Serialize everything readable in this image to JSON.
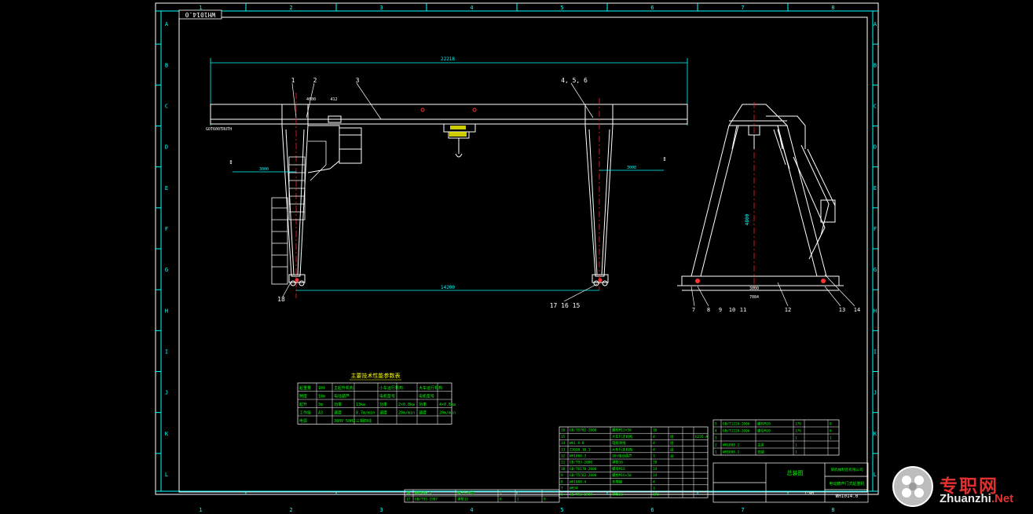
{
  "drawing": {
    "number_box": "WH1014.0",
    "column_labels": [
      "1",
      "2",
      "3",
      "4",
      "5",
      "6",
      "7",
      "8"
    ],
    "row_labels": [
      "A",
      "B",
      "C",
      "D",
      "E",
      "F",
      "G",
      "H",
      "I",
      "J",
      "K",
      "L"
    ],
    "front_view": {
      "span_dim": "22218",
      "rail_dim": "14200",
      "left_overhang": "3000",
      "right_overhang": "3000",
      "hook_level": "GOT600TRUTH",
      "detail_dim_a": "4600",
      "detail_dim_b": "412",
      "callouts_top": [
        "1",
        "2",
        "3",
        "4, 5, 6"
      ],
      "callouts_bottom_left": "18",
      "callouts_bottom_right": "17  16  15"
    },
    "side_view": {
      "height_dim": "4800",
      "base_dim_a": "3000",
      "base_dim_b": "7084",
      "callouts": [
        "7",
        "8",
        "9",
        "10",
        "11",
        "12",
        "13",
        "14"
      ]
    },
    "spec_table": {
      "title": "主要技术性能参数表",
      "rows": [
        [
          "起重量",
          "10t",
          "主起升机构",
          "",
          "小车运行机构",
          "",
          "大车运行机构",
          ""
        ],
        [
          "跨度",
          "18m",
          "电动葫芦",
          "",
          "电机型号",
          "",
          "电机型号",
          ""
        ],
        [
          "起升",
          "3m",
          "功率",
          "13kw",
          "功率",
          "2×0.8kw",
          "功率",
          "4×0.8kw"
        ],
        [
          "工作级",
          "A3",
          "速度",
          "8.7m/min",
          "速度",
          "20m/min",
          "速度",
          "20m/min"
        ],
        [
          "电源",
          "",
          "380V 50HZ",
          "三相四线",
          "",
          "",
          "",
          ""
        ]
      ]
    },
    "parts_list_left": [
      [
        "16",
        "GB/T5782-2000",
        "螺栓M12×50",
        "16",
        "",
        "",
        ""
      ],
      [
        "15",
        "",
        "大车行走机构",
        "4",
        "组",
        "",
        "Q235-A"
      ],
      [
        "14",
        "WH1-A-8",
        "电缆滑线",
        "4",
        "组",
        "",
        ""
      ],
      [
        "13",
        "ZJQ10.10.1",
        "大车行走机构",
        "4",
        "组",
        "",
        ""
      ],
      [
        "12",
        "WH1008.3",
        "10t电动葫芦",
        "1",
        "台",
        "",
        ""
      ],
      [
        "11",
        "GB/T93-2000",
        "弹垫16",
        "28",
        "",
        "",
        ""
      ],
      [
        "10",
        "GB/T6170-2000",
        "螺母M16",
        "24",
        "",
        "",
        ""
      ],
      [
        "9",
        "GB/T5782-2000",
        "螺栓M16×50",
        "24",
        "",
        "",
        ""
      ],
      [
        "8",
        "WH1008.4",
        "支撑腿",
        "4",
        "",
        "",
        ""
      ],
      [
        "7",
        "WH34",
        "",
        "1",
        "",
        "",
        ""
      ],
      [
        "6",
        "GB/T93-1987",
        "弹垫20",
        "176",
        "",
        "",
        ""
      ]
    ],
    "parts_list_bottom": [
      [
        "18",
        "WH1008.5",
        "梯子与平台",
        "1",
        "",
        ""
      ],
      [
        "17",
        "GB/T93-1987",
        "弹垫12",
        "8",
        "1",
        "9"
      ]
    ],
    "parts_list_right": [
      [
        "5",
        "GB/T1228-2006",
        "螺栓M20",
        "176",
        "",
        "0"
      ],
      [
        "4",
        "GB/T1228-2006",
        "螺母M20",
        "176",
        "",
        "0"
      ],
      [
        "3",
        "",
        "",
        "1",
        "",
        "1"
      ],
      [
        "2",
        "WH1008.2",
        "主梁",
        "1",
        "",
        ""
      ],
      [
        "1",
        "WH1008.1",
        "支腿",
        "1",
        "",
        ""
      ]
    ],
    "title_block": {
      "company": "某机械制造有限公司",
      "drawing_name": "电动葫芦门式起重机",
      "drawing_no": "WH1014.0",
      "scale": "1:40",
      "label_a": "总装图"
    }
  },
  "watermark": {
    "text": "专职网",
    "url_prefix": "Zhuanzhi",
    "url_suffix": ".Net"
  },
  "colors": {
    "frame": "#ffffff",
    "zone_grid": "#00ffff",
    "geometry": "#ffffff",
    "dimension": "#00ffff",
    "centerline": "#ff2020",
    "green": "#00ff00",
    "yellow": "#ffff00"
  }
}
